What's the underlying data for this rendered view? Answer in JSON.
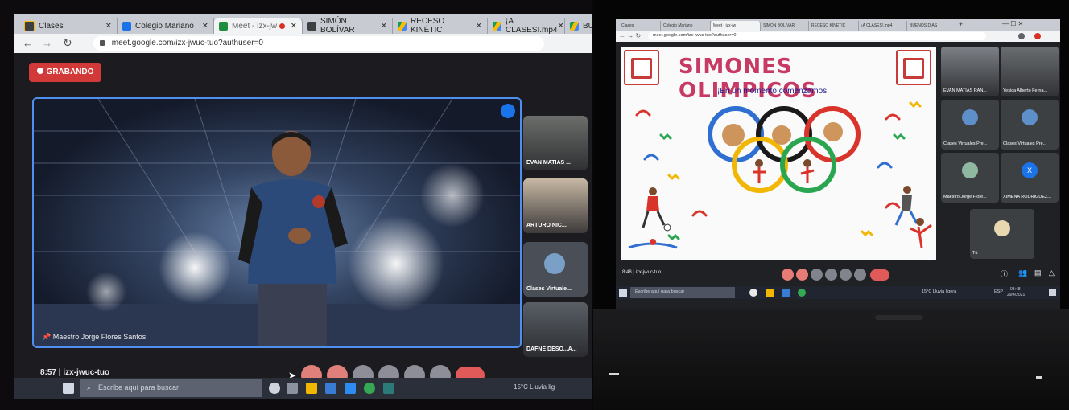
{
  "left": {
    "tabs": [
      {
        "label": "Clases",
        "color": "#3c4043"
      },
      {
        "label": "Colegio Mariano",
        "color": "#1a73e8"
      },
      {
        "label": "Meet - izx-jw",
        "color": "#f1a33a",
        "active": true
      },
      {
        "label": "SIMÓN BOLÍVAR",
        "color": "#3c4043"
      },
      {
        "label": "RECESO KINÉTIC",
        "color": "#4285f4"
      },
      {
        "label": "¡A CLASES!.mp4",
        "color": "#fbbc04"
      },
      {
        "label": "BUEN",
        "color": "#4285f4"
      }
    ],
    "url": "meet.google.com/izx-jwuc-tuo?authuser=0",
    "record_label": "GRABANDO",
    "presenter_name": "Maestro Jorge Flores Santos",
    "tiles": [
      "EVAN MATIAS ...",
      "ARTURO NIC...",
      "Clases Virtuale...",
      "DAFNE DESO...A..."
    ],
    "meeting_info": "8:57  |  izx-jwuc-tuo",
    "search_placeholder": "Escribe aquí para buscar",
    "weather": "15°C  Lluvia lig"
  },
  "right": {
    "tabs": [
      {
        "label": "Clases",
        "active": false
      },
      {
        "label": "Colegio Mariano",
        "active": false
      },
      {
        "label": "Meet - izx-jw",
        "active": true
      },
      {
        "label": "SIMÓN BOLÍVAR",
        "active": false
      },
      {
        "label": "RECESO KINÉTIC",
        "active": false
      },
      {
        "label": "¡A CLASES!.mp4",
        "active": false
      },
      {
        "label": "BUENOS DÍAS",
        "active": false
      }
    ],
    "url": "meet.google.com/izx-jwuc-tuo?authuser=0",
    "slide": {
      "title": "SIMONES OLIMPICOS",
      "subtitle": "¡En un momento comenzamos!"
    },
    "participants": [
      {
        "name": "EVAN MATIAS RAN...",
        "initial": ""
      },
      {
        "name": "Yesica Alberto Ferna...",
        "initial": ""
      },
      {
        "name": "Clases Virtuales Pre...",
        "initial": ""
      },
      {
        "name": "Clases Virtuales Pre...",
        "initial": ""
      },
      {
        "name": "Maestro Jorge Flore...",
        "initial": ""
      },
      {
        "name": "XIMENA RODRIGUEZ...",
        "initial": "X"
      }
    ],
    "self_label": "Tú",
    "meeting_info": "8:48  |  izx-jwuc-tuo",
    "search_placeholder": "Escribe aquí para buscar",
    "weather": "15°C  Lluvia ligera",
    "tray": "ESP",
    "clock_time": "08:48",
    "clock_date": "29/4/2021"
  }
}
